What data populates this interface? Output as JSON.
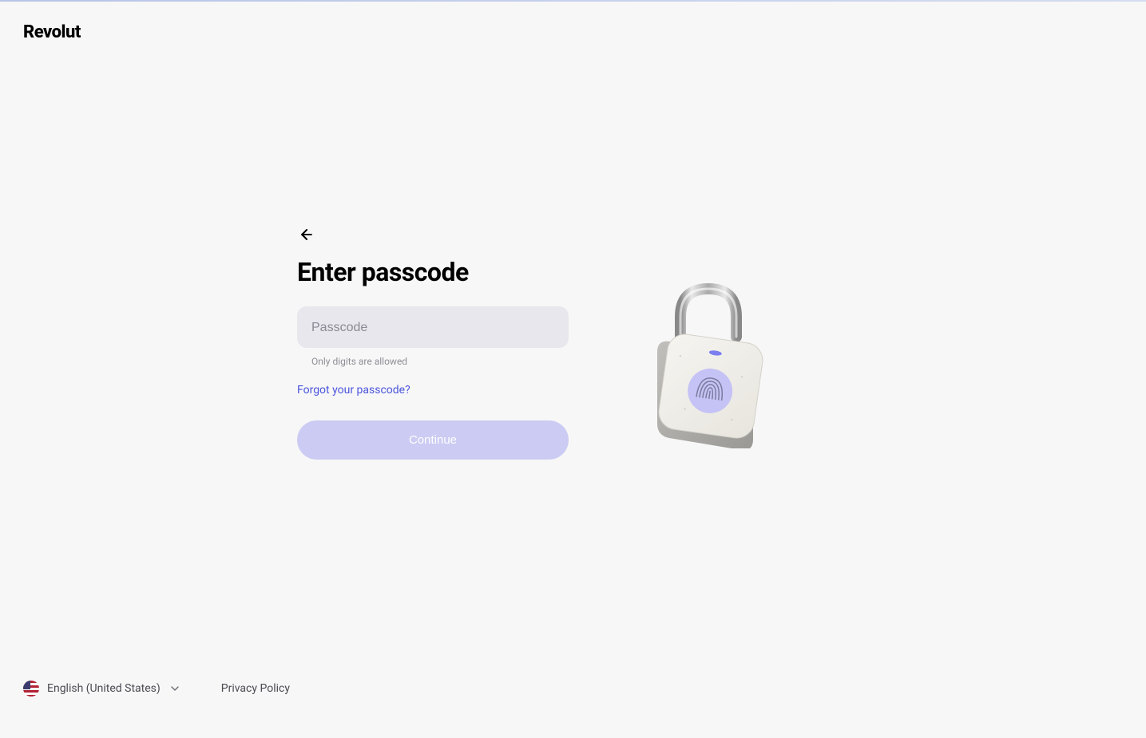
{
  "header": {
    "logo_text": "Revolut"
  },
  "main": {
    "heading": "Enter passcode",
    "passcode_placeholder": "Passcode",
    "passcode_value": "",
    "hint_text": "Only digits are allowed",
    "forgot_link_text": "Forgot your passcode?",
    "continue_button_label": "Continue"
  },
  "footer": {
    "language_label": "English (United States)",
    "privacy_link_label": "Privacy Policy"
  },
  "icons": {
    "back_arrow": "arrow-left-icon",
    "chevron": "chevron-down-icon",
    "flag": "us-flag-icon",
    "lock_illustration": "fingerprint-lock-icon"
  }
}
